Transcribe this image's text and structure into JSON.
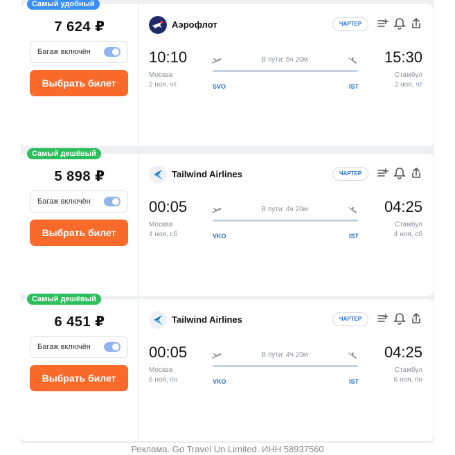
{
  "colors": {
    "accent_orange": "#fa6a2b",
    "badge_blue": "#3a8ef6",
    "badge_green": "#2bbf5b",
    "link_blue": "#2b6fcf",
    "aeroflot_navy": "#1f2a6b"
  },
  "tickets": [
    {
      "badge": "Самый удобный",
      "badge_color": "#3a8ef6",
      "price": "7 624 ₽",
      "baggage_label": "Багаж включён",
      "baggage_on": true,
      "buy_label": "Выбрать билет",
      "airline": "Аэрофлот",
      "logo_icon": "aeroflot-logo-icon",
      "charter_label": "ЧАРТЕР",
      "depart_time": "10:10",
      "depart_city": "Москва",
      "depart_date": "2 ноя, чт",
      "depart_code": "SVO",
      "duration": "В пути: 5ч 20м",
      "arrive_time": "15:30",
      "arrive_city": "Стамбул",
      "arrive_date": "2 ноя, чт",
      "arrive_code": "IST"
    },
    {
      "badge": "Самый дешёвый",
      "badge_color": "#2bbf5b",
      "price": "5 898 ₽",
      "baggage_label": "Багаж включён",
      "baggage_on": true,
      "buy_label": "Выбрать билет",
      "airline": "Tailwind Airlines",
      "logo_icon": "tailwind-logo-icon",
      "charter_label": "ЧАРТЕР",
      "depart_time": "00:05",
      "depart_city": "Москва",
      "depart_date": "4 ноя, сб",
      "depart_code": "VKO",
      "duration": "В пути: 4ч 20м",
      "arrive_time": "04:25",
      "arrive_city": "Стамбул",
      "arrive_date": "4 ноя, сб",
      "arrive_code": "IST"
    },
    {
      "badge": "Самый дешёвый",
      "badge_color": "#2bbf5b",
      "price": "6 451 ₽",
      "baggage_label": "Багаж включён",
      "baggage_on": true,
      "buy_label": "Выбрать билет",
      "airline": "Tailwind Airlines",
      "logo_icon": "tailwind-logo-icon",
      "charter_label": "ЧАРТЕР",
      "depart_time": "00:05",
      "depart_city": "Москва",
      "depart_date": "6 ноя, пн",
      "depart_code": "VKO",
      "duration": "В пути: 4ч 20м",
      "arrive_time": "04:25",
      "arrive_city": "Стамбул",
      "arrive_date": "6 ноя, пн",
      "arrive_code": "IST"
    }
  ],
  "footer": "Реклама. Go Travel Un Limited. ИНН 58937560"
}
